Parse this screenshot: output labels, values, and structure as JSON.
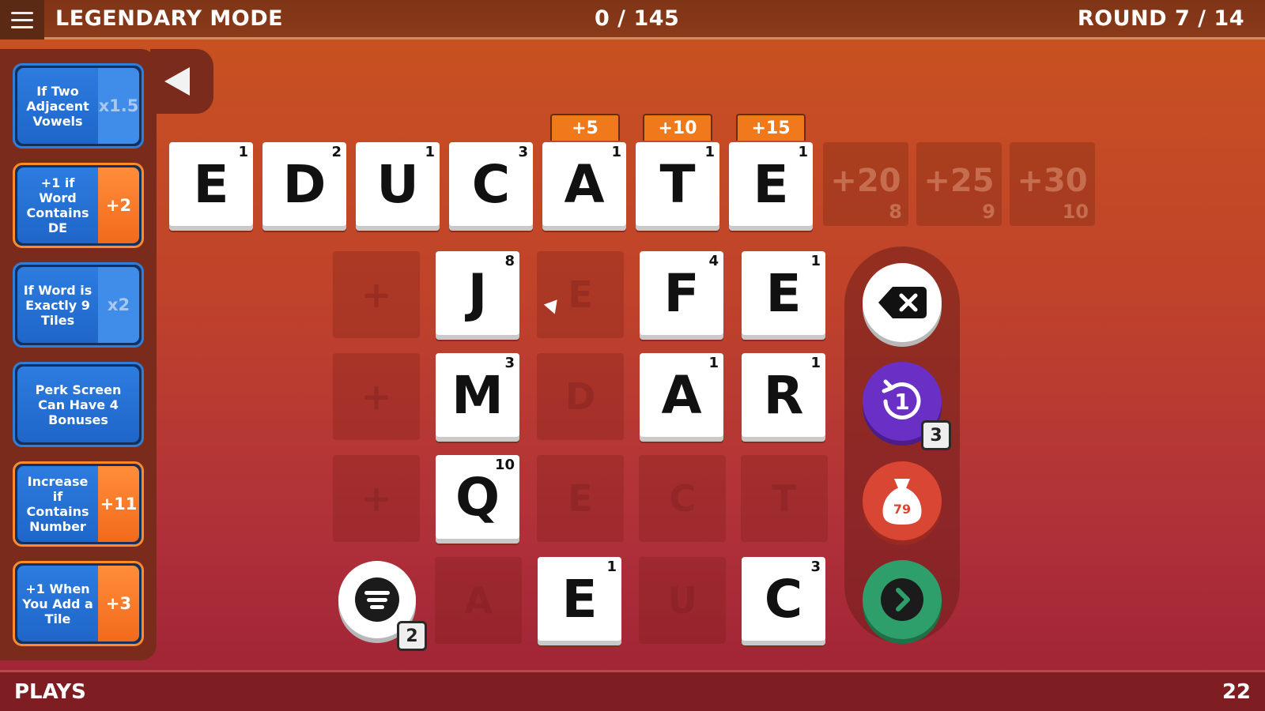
{
  "header": {
    "title": "LEGENDARY MODE",
    "score": "0 / 145",
    "round": "ROUND 7 / 14"
  },
  "footer": {
    "label": "PLAYS",
    "count": "22"
  },
  "perks": [
    {
      "text": "If Two Adjacent Vowels",
      "value": "x1.5",
      "style": "blue"
    },
    {
      "text": "+1 if Word Contains DE",
      "value": "+2",
      "style": "orange"
    },
    {
      "text": "If Word is Exactly 9 Tiles",
      "value": "x2",
      "style": "blue"
    },
    {
      "text": "Perk Screen Can Have 4 Bonuses",
      "value": "",
      "style": "blue"
    },
    {
      "text": "Increase if Contains Number",
      "value": "+11",
      "style": "orange"
    },
    {
      "text": "+1 When You Add a Tile",
      "value": "+3",
      "style": "orange"
    }
  ],
  "word": [
    {
      "letter": "E",
      "points": "1"
    },
    {
      "letter": "D",
      "points": "2"
    },
    {
      "letter": "U",
      "points": "1"
    },
    {
      "letter": "C",
      "points": "3"
    },
    {
      "letter": "A",
      "points": "1"
    },
    {
      "letter": "T",
      "points": "1"
    },
    {
      "letter": "E",
      "points": "1"
    }
  ],
  "bonus_tags": [
    "+5",
    "+10",
    "+15"
  ],
  "empty_slots": [
    {
      "bonus": "+20",
      "index": "8"
    },
    {
      "bonus": "+25",
      "index": "9"
    },
    {
      "bonus": "+30",
      "index": "10"
    }
  ],
  "hand_tiles": [
    {
      "letter": "J",
      "points": "8"
    },
    {
      "letter": "F",
      "points": "4"
    },
    {
      "letter": "E",
      "points": "1"
    },
    {
      "letter": "M",
      "points": "3"
    },
    {
      "letter": "A",
      "points": "1"
    },
    {
      "letter": "R",
      "points": "1"
    },
    {
      "letter": "Q",
      "points": "10"
    },
    {
      "letter": "E",
      "points": "1"
    },
    {
      "letter": "C",
      "points": "3"
    }
  ],
  "ghost_letters": [
    "E",
    "D",
    "E",
    "C",
    "T",
    "A",
    "U"
  ],
  "add_slot_symbol": "+",
  "actions": {
    "delete_icon": "backspace-icon",
    "undo_value": "1",
    "undo_count": "3",
    "bag_count": "79",
    "sort_count": "2"
  }
}
